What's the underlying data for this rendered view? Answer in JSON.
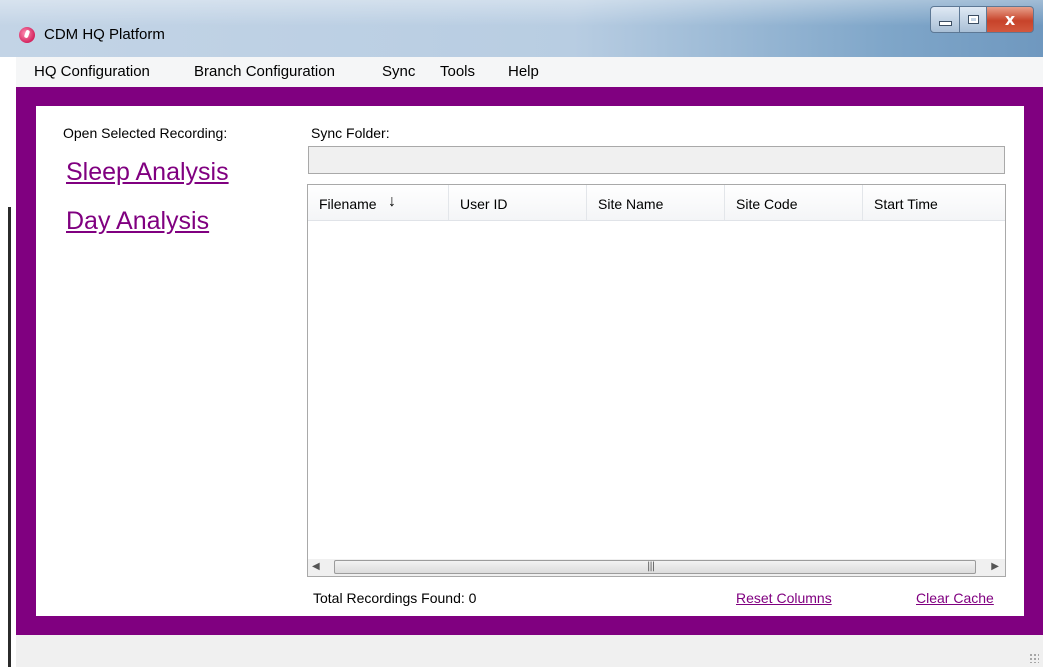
{
  "window": {
    "title": "CDM HQ Platform",
    "close_glyph": "x"
  },
  "menu": {
    "items": [
      "HQ Configuration",
      "Branch Configuration",
      "Sync",
      "Tools",
      "Help"
    ]
  },
  "left_panel": {
    "open_label": "Open Selected Recording:",
    "links": [
      "Sleep Analysis",
      "Day Analysis"
    ]
  },
  "sync": {
    "label": "Sync Folder:",
    "value": ""
  },
  "list": {
    "columns": [
      "Filename",
      "User ID",
      "Site Name",
      "Site Code",
      "Start Time"
    ],
    "sort_indicator": "↓",
    "rows": []
  },
  "footer": {
    "total_label": "Total Recordings Found:",
    "total_count": "0",
    "reset_columns": "Reset Columns",
    "clear_cache": "Clear Cache"
  },
  "colors": {
    "accent": "#800080",
    "link": "#800080"
  },
  "icons": {
    "app": "app-logo-icon",
    "sort": "sort-down-icon",
    "scroll_left": "scroll-left-icon",
    "scroll_right": "scroll-right-icon",
    "resize_grip": "resize-grip-icon"
  }
}
